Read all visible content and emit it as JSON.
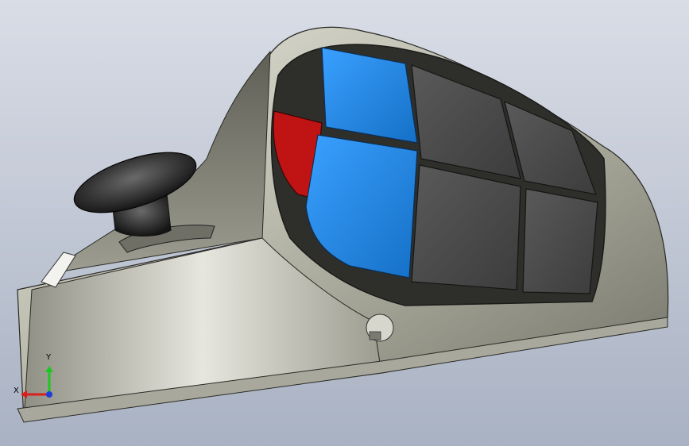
{
  "viewport": {
    "background_top": "#d9dde6",
    "background_bottom": "#a9b2c3"
  },
  "model": {
    "body_color": "#b9b9ab",
    "key_blue": "#1e86e0",
    "key_dark": "#4a4a4a",
    "trigger_red": "#c01414",
    "joystick_color": "#1a1a1a"
  },
  "triad": {
    "x_label": "X",
    "y_label": "Y",
    "x_color": "#d81e1e",
    "y_color": "#1ec81e",
    "z_color": "#1e3cd8"
  }
}
